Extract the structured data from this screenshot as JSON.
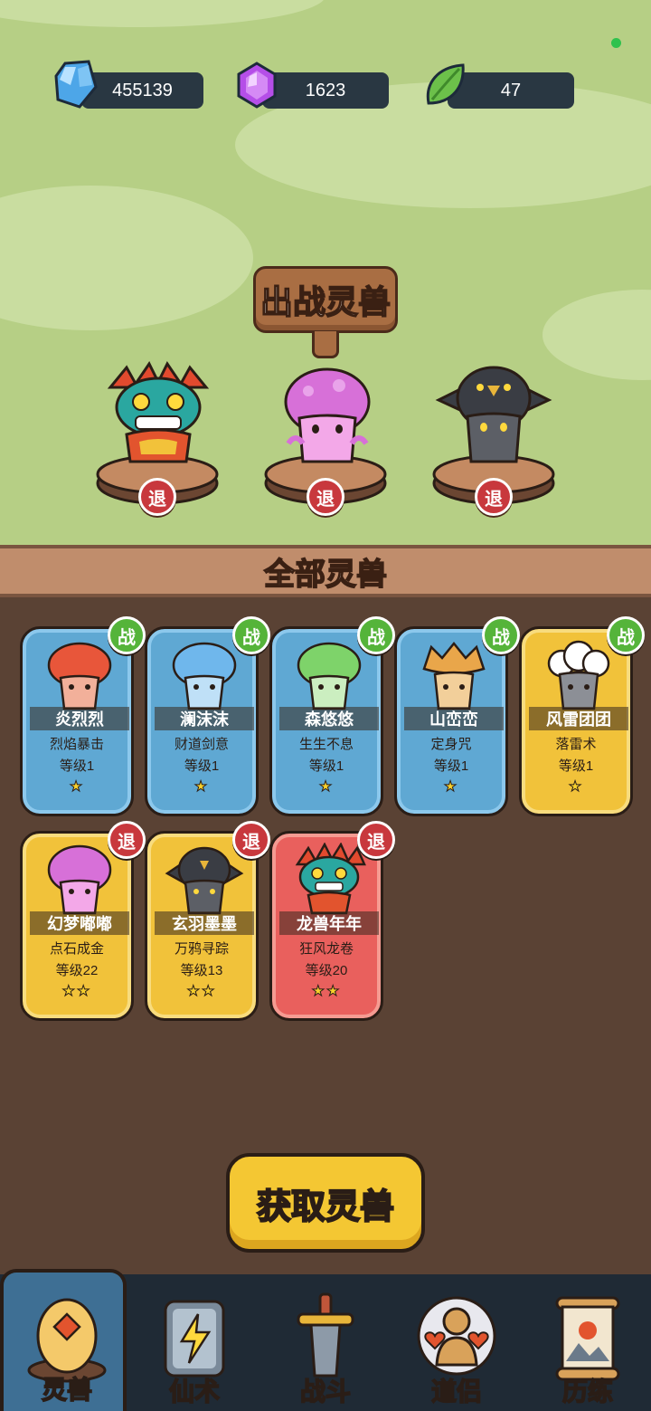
{
  "resources": [
    {
      "icon": "blue-crystal-icon",
      "value": "455139"
    },
    {
      "icon": "purple-gem-icon",
      "value": "1623"
    },
    {
      "icon": "green-leaf-icon",
      "value": "47"
    }
  ],
  "deploy": {
    "title": "出战灵兽",
    "retreat_label": "退",
    "slots": [
      {
        "monster": "dragon-beast"
      },
      {
        "monster": "pink-mushroom"
      },
      {
        "monster": "crow-mushroom"
      }
    ]
  },
  "all_beasts": {
    "title": "全部灵兽",
    "cards": [
      {
        "name": "炎烈烈",
        "skill": "烈焰暴击",
        "level": "等级1",
        "stars": "★",
        "badge": "战",
        "color": "blue"
      },
      {
        "name": "澜沫沫",
        "skill": "财道剑意",
        "level": "等级1",
        "stars": "★",
        "badge": "战",
        "color": "blue"
      },
      {
        "name": "森悠悠",
        "skill": "生生不息",
        "level": "等级1",
        "stars": "★",
        "badge": "战",
        "color": "blue"
      },
      {
        "name": "山峦峦",
        "skill": "定身咒",
        "level": "等级1",
        "stars": "★",
        "badge": "战",
        "color": "blue"
      },
      {
        "name": "风雷团团",
        "skill": "落雷术",
        "level": "等级1",
        "stars": "★",
        "badge": "战",
        "color": "yellow"
      },
      {
        "name": "幻梦嘟嘟",
        "skill": "点石成金",
        "level": "等级22",
        "stars": "★★",
        "badge": "退",
        "color": "yellow"
      },
      {
        "name": "玄羽墨墨",
        "skill": "万鸦寻踪",
        "level": "等级13",
        "stars": "★★",
        "badge": "退",
        "color": "yellow"
      },
      {
        "name": "龙兽年年",
        "skill": "狂风龙卷",
        "level": "等级20",
        "stars": "★★",
        "badge": "退",
        "color": "red"
      }
    ]
  },
  "obtain_button": "获取灵兽",
  "nav": [
    {
      "label": "灵兽",
      "icon": "egg-icon",
      "active": true
    },
    {
      "label": "仙术",
      "icon": "lightning-card-icon",
      "active": false
    },
    {
      "label": "战斗",
      "icon": "sword-icon",
      "active": false
    },
    {
      "label": "道侣",
      "icon": "companion-icon",
      "active": false
    },
    {
      "label": "历练",
      "icon": "scroll-icon",
      "active": false
    }
  ],
  "colors": {
    "meadow": "#b6cf85",
    "panel": "#5a4234",
    "card_blue": "#5fa8d3",
    "card_yellow": "#f1c23a",
    "card_red": "#e9605d",
    "badge_fight": "#55b43a",
    "badge_retreat": "#c8383d"
  }
}
